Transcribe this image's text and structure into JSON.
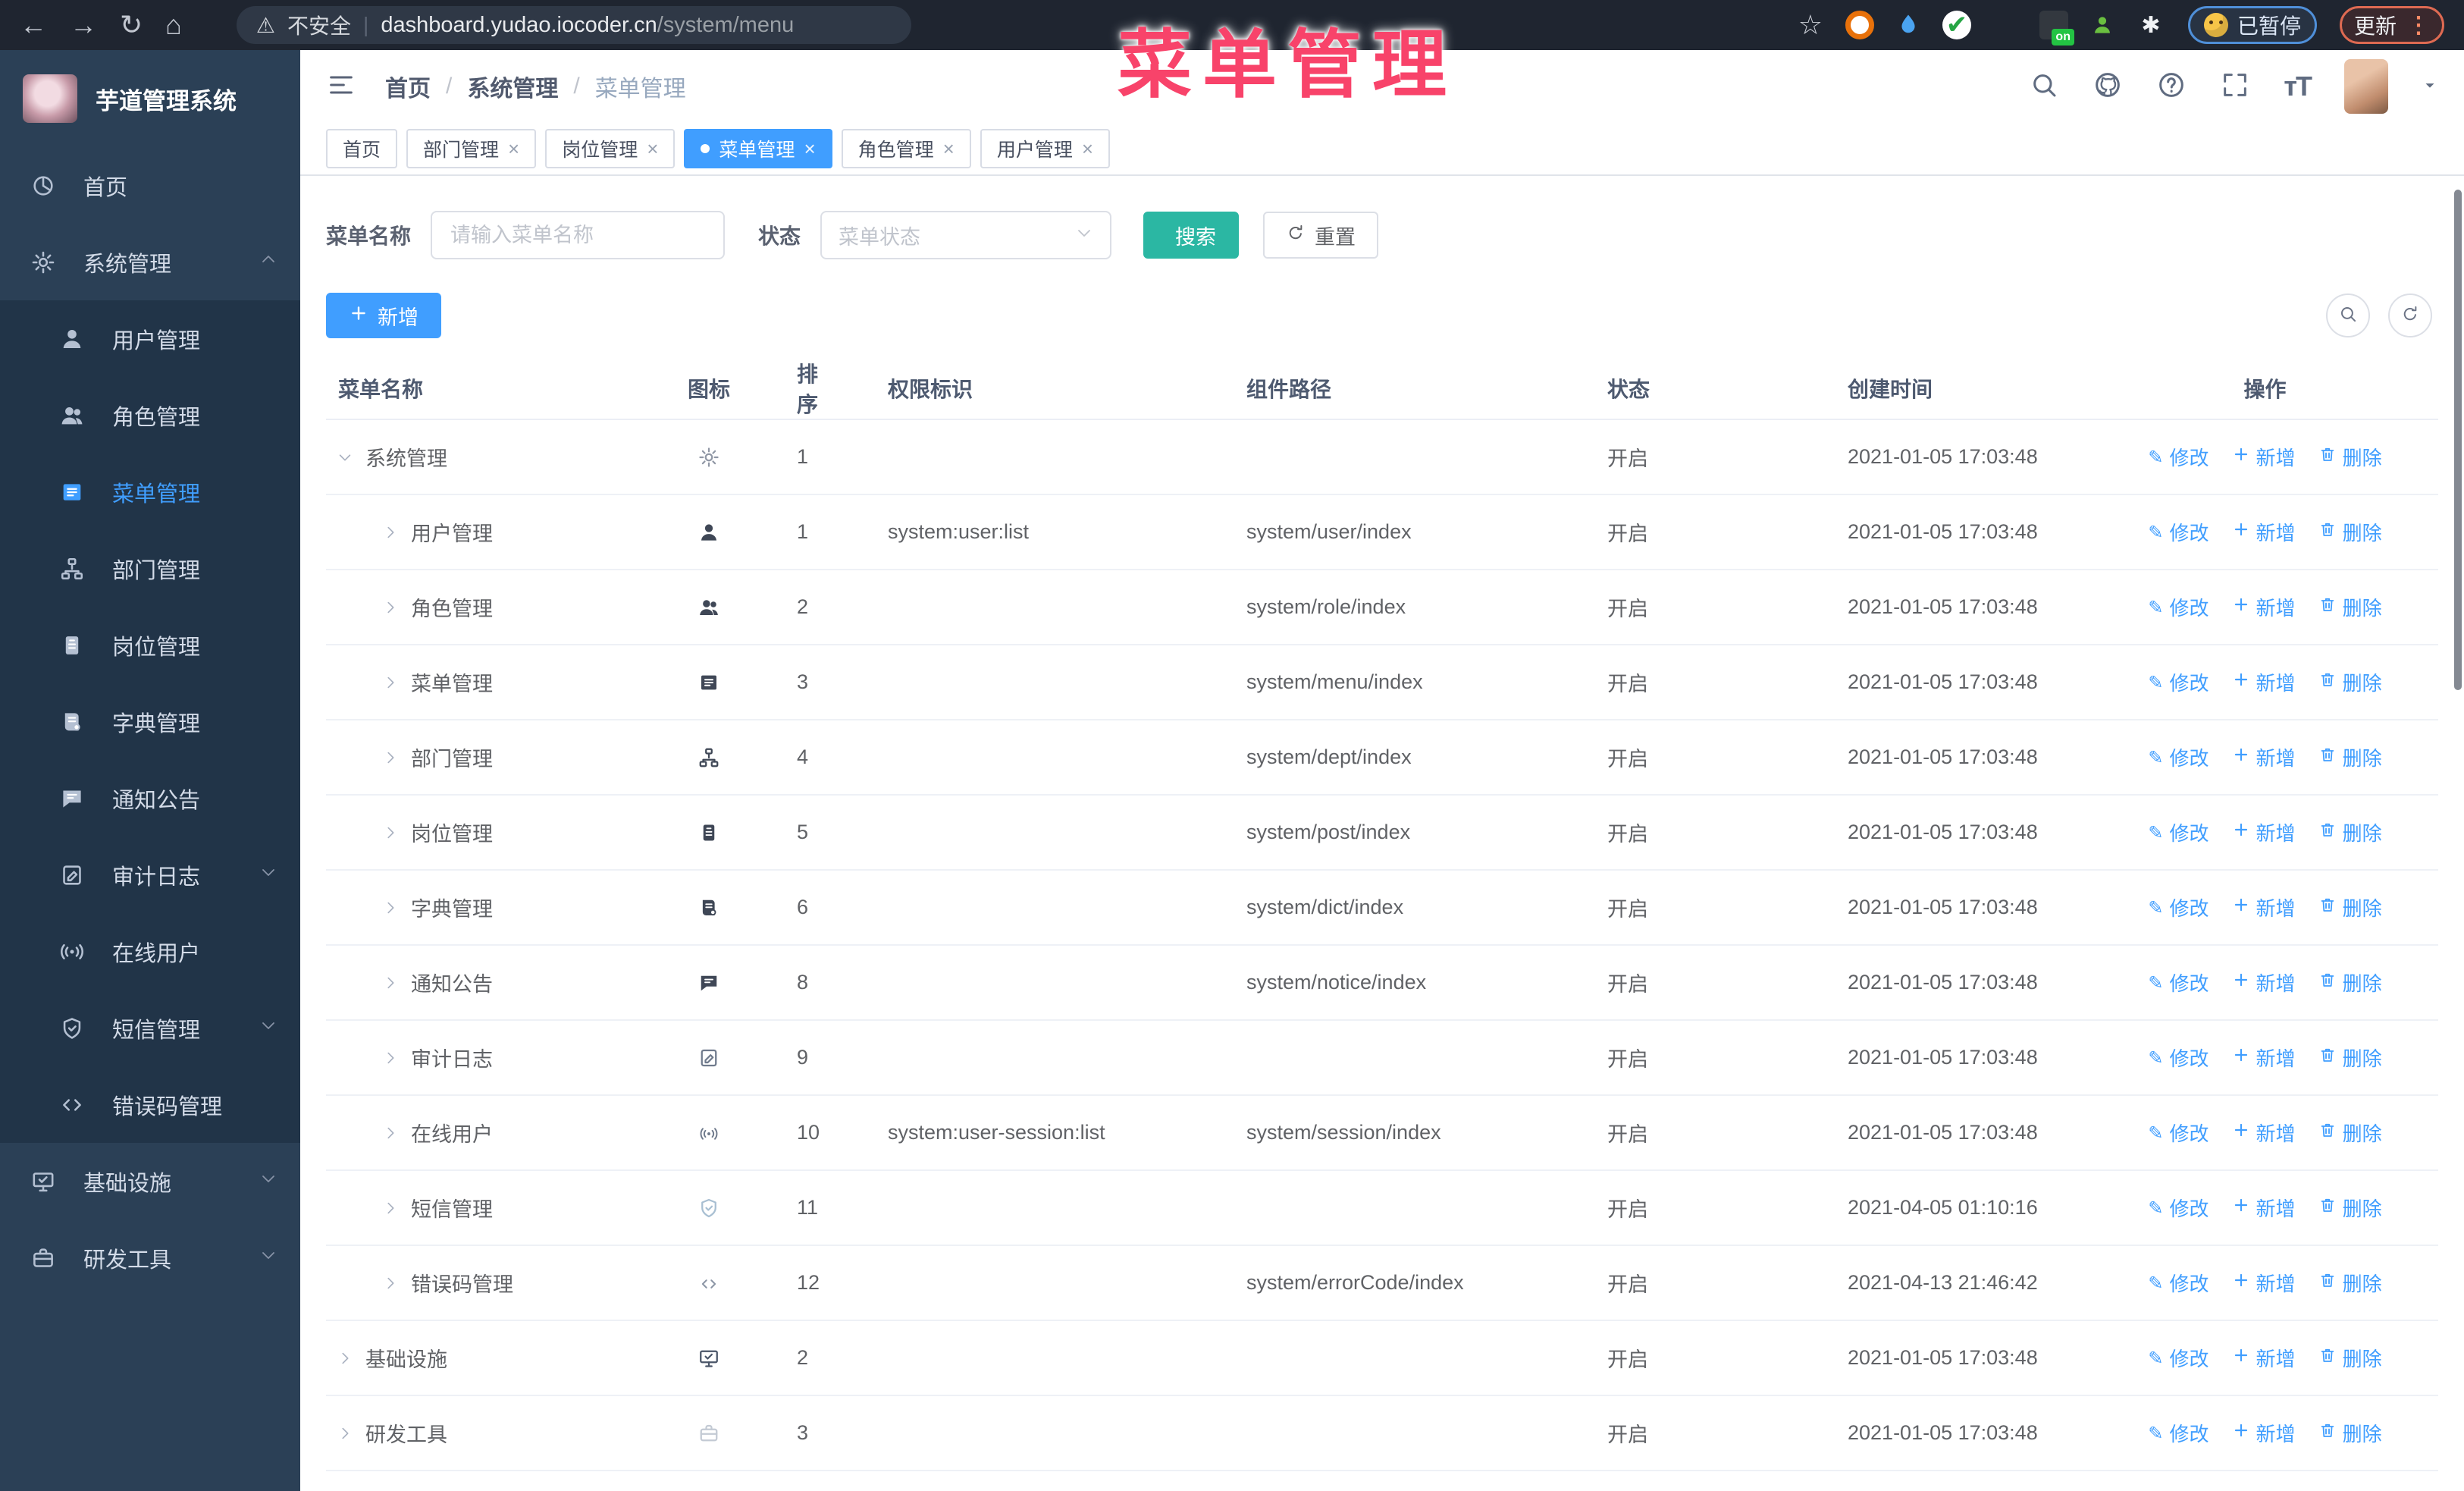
{
  "browser": {
    "nav": [
      "back",
      "forward",
      "reload",
      "home"
    ],
    "security_label": "不安全",
    "url_host": "dashboard.yudao.iocoder.cn",
    "url_path": "/system/menu",
    "extensions": [
      "orange-ring",
      "water-drop",
      "green-circle",
      "blue-grid",
      "screen-on",
      "green-person",
      "puzzle"
    ],
    "paused_label": "已暂停",
    "update_label": "更新"
  },
  "overlay_title": "菜单管理",
  "sidebar": {
    "title": "芋道管理系统",
    "items": [
      {
        "label": "首页",
        "icon": "dashboard",
        "level": 0
      },
      {
        "label": "系统管理",
        "icon": "gear",
        "level": 0,
        "caret": "up",
        "expanded": true
      },
      {
        "label": "用户管理",
        "icon": "user",
        "level": 1
      },
      {
        "label": "角色管理",
        "icon": "users",
        "level": 1
      },
      {
        "label": "菜单管理",
        "icon": "list",
        "level": 1,
        "active": true
      },
      {
        "label": "部门管理",
        "icon": "tree",
        "level": 1
      },
      {
        "label": "岗位管理",
        "icon": "badge",
        "level": 1
      },
      {
        "label": "字典管理",
        "icon": "book",
        "level": 1
      },
      {
        "label": "通知公告",
        "icon": "message",
        "level": 1
      },
      {
        "label": "审计日志",
        "icon": "audit",
        "level": 1,
        "caret": "down"
      },
      {
        "label": "在线用户",
        "icon": "online",
        "level": 1
      },
      {
        "label": "短信管理",
        "icon": "shield",
        "level": 1,
        "caret": "down"
      },
      {
        "label": "错误码管理",
        "icon": "code",
        "level": 1
      },
      {
        "label": "基础设施",
        "icon": "monitor",
        "level": 0,
        "caret": "down"
      },
      {
        "label": "研发工具",
        "icon": "suitcase",
        "level": 0,
        "caret": "down"
      }
    ]
  },
  "header": {
    "breadcrumb": [
      "首页",
      "系统管理",
      "菜单管理"
    ],
    "icons": [
      "search",
      "github",
      "question",
      "fullscreen",
      "font-size"
    ]
  },
  "tabs": [
    {
      "label": "首页",
      "closable": false,
      "active": false
    },
    {
      "label": "部门管理",
      "closable": true,
      "active": false
    },
    {
      "label": "岗位管理",
      "closable": true,
      "active": false
    },
    {
      "label": "菜单管理",
      "closable": true,
      "active": true
    },
    {
      "label": "角色管理",
      "closable": true,
      "active": false
    },
    {
      "label": "用户管理",
      "closable": true,
      "active": false
    }
  ],
  "filters": {
    "name_label": "菜单名称",
    "name_placeholder": "请输入菜单名称",
    "name_value": "",
    "status_label": "状态",
    "status_placeholder": "菜单状态",
    "search_label": "搜索",
    "reset_label": "重置"
  },
  "toolbar": {
    "add_label": "新增",
    "icons": [
      "search",
      "refresh"
    ]
  },
  "table": {
    "columns": [
      "菜单名称",
      "图标",
      "排序",
      "权限标识",
      "组件路径",
      "状态",
      "创建时间",
      "操作"
    ],
    "actions": {
      "edit": "修改",
      "add": "新增",
      "delete": "删除"
    },
    "rows": [
      {
        "name": "系统管理",
        "icon": "gear",
        "sort": "1",
        "perm": "",
        "path": "",
        "status": "开启",
        "created": "2021-01-05 17:03:48",
        "level": 0,
        "expanded": true
      },
      {
        "name": "用户管理",
        "icon": "user",
        "sort": "1",
        "perm": "system:user:list",
        "path": "system/user/index",
        "status": "开启",
        "created": "2021-01-05 17:03:48",
        "level": 1,
        "expanded": false
      },
      {
        "name": "角色管理",
        "icon": "users",
        "sort": "2",
        "perm": "",
        "path": "system/role/index",
        "status": "开启",
        "created": "2021-01-05 17:03:48",
        "level": 1,
        "expanded": false
      },
      {
        "name": "菜单管理",
        "icon": "list",
        "sort": "3",
        "perm": "",
        "path": "system/menu/index",
        "status": "开启",
        "created": "2021-01-05 17:03:48",
        "level": 1,
        "expanded": false
      },
      {
        "name": "部门管理",
        "icon": "tree",
        "sort": "4",
        "perm": "",
        "path": "system/dept/index",
        "status": "开启",
        "created": "2021-01-05 17:03:48",
        "level": 1,
        "expanded": false
      },
      {
        "name": "岗位管理",
        "icon": "badge",
        "sort": "5",
        "perm": "",
        "path": "system/post/index",
        "status": "开启",
        "created": "2021-01-05 17:03:48",
        "level": 1,
        "expanded": false
      },
      {
        "name": "字典管理",
        "icon": "book",
        "sort": "6",
        "perm": "",
        "path": "system/dict/index",
        "status": "开启",
        "created": "2021-01-05 17:03:48",
        "level": 1,
        "expanded": false
      },
      {
        "name": "通知公告",
        "icon": "message",
        "sort": "8",
        "perm": "",
        "path": "system/notice/index",
        "status": "开启",
        "created": "2021-01-05 17:03:48",
        "level": 1,
        "expanded": false
      },
      {
        "name": "审计日志",
        "icon": "audit",
        "sort": "9",
        "perm": "",
        "path": "",
        "status": "开启",
        "created": "2021-01-05 17:03:48",
        "level": 1,
        "expanded": false
      },
      {
        "name": "在线用户",
        "icon": "online",
        "sort": "10",
        "perm": "system:user-session:list",
        "path": "system/session/index",
        "status": "开启",
        "created": "2021-01-05 17:03:48",
        "level": 1,
        "expanded": false
      },
      {
        "name": "短信管理",
        "icon": "shield",
        "sort": "11",
        "perm": "",
        "path": "",
        "status": "开启",
        "created": "2021-04-05 01:10:16",
        "level": 1,
        "expanded": false
      },
      {
        "name": "错误码管理",
        "icon": "code",
        "sort": "12",
        "perm": "",
        "path": "system/errorCode/index",
        "status": "开启",
        "created": "2021-04-13 21:46:42",
        "level": 1,
        "expanded": false
      },
      {
        "name": "基础设施",
        "icon": "monitor",
        "sort": "2",
        "perm": "",
        "path": "",
        "status": "开启",
        "created": "2021-01-05 17:03:48",
        "level": 0,
        "expanded": false
      },
      {
        "name": "研发工具",
        "icon": "suitcase",
        "sort": "3",
        "perm": "",
        "path": "",
        "status": "开启",
        "created": "2021-01-05 17:03:48",
        "level": 0,
        "expanded": false
      }
    ]
  },
  "colors": {
    "accent": "#409eff",
    "search_button": "#2bb7a3",
    "sidebar_bg": "#2b4056",
    "sidebar_submenu_bg": "#213448",
    "overlay_title": "#f8436a",
    "chrome_bar": "#1f2530",
    "status_text": "#606266",
    "link": "#409eff"
  }
}
